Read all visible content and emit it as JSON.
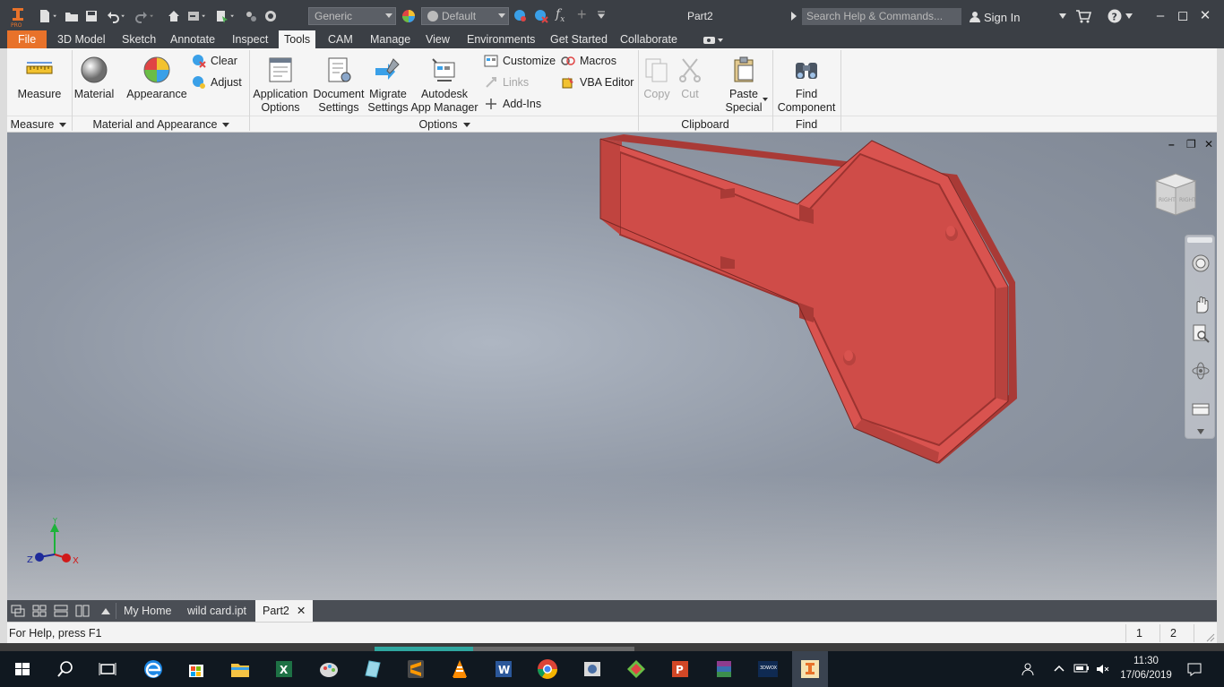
{
  "titlebar": {
    "document_title": "Part2",
    "material_dropdown": "Generic",
    "appearance_dropdown": "Default",
    "search_placeholder": "Search Help & Commands...",
    "sign_in": "Sign In"
  },
  "ribbon_tabs": [
    "File",
    "3D Model",
    "Sketch",
    "Annotate",
    "Inspect",
    "Tools",
    "CAM",
    "Manage",
    "View",
    "Environments",
    "Get Started",
    "Collaborate"
  ],
  "active_tab": "Tools",
  "ribbon": {
    "measure": {
      "button": "Measure",
      "panel": "Measure"
    },
    "material_appearance": {
      "material": "Material",
      "appearance": "Appearance",
      "clear": "Clear",
      "adjust": "Adjust",
      "panel": "Material and Appearance"
    },
    "options": {
      "application_options": [
        "Application",
        "Options"
      ],
      "document_settings": [
        "Document",
        "Settings"
      ],
      "migrate_settings": [
        "Migrate",
        "Settings"
      ],
      "app_manager": [
        "Autodesk",
        "App Manager"
      ],
      "customize": "Customize",
      "links": "Links",
      "add_ins": "Add-Ins",
      "macros": "Macros",
      "vba_editor": "VBA Editor",
      "panel": "Options"
    },
    "clipboard": {
      "copy": "Copy",
      "cut": "Cut",
      "paste_special": [
        "Paste",
        "Special"
      ],
      "panel": "Clipboard"
    },
    "find": {
      "find_component": [
        "Find",
        "Component"
      ],
      "panel": "Find"
    }
  },
  "viewcube": {
    "faces": [
      "RIGHT",
      "RIGHT"
    ]
  },
  "axis_triad": {
    "x": "X",
    "y": "Y",
    "z": "Z"
  },
  "model": {
    "color": "#d9534f"
  },
  "doc_tabs": [
    "My Home",
    "wild card.ipt",
    "Part2"
  ],
  "active_doc_tab": "Part2",
  "status": {
    "help_text": "For Help, press F1",
    "count1": "1",
    "count2": "2"
  },
  "taskbar": {
    "time": "11:30",
    "date": "17/06/2019",
    "apps": [
      "start",
      "search",
      "task-view",
      "edge",
      "store",
      "file-explorer",
      "excel",
      "paint",
      "ice",
      "sublime",
      "vlc",
      "word",
      "chrome",
      "tool",
      "paint-net",
      "powerpoint",
      "winrar",
      "3dwox",
      "inventor"
    ]
  }
}
